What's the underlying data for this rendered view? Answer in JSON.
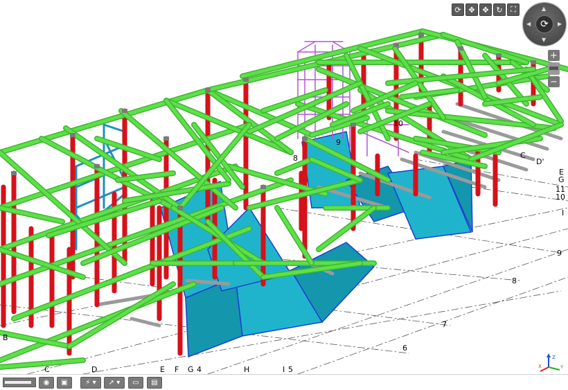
{
  "grid_labels": {
    "letters_bottom": [
      "B",
      "C",
      "D",
      "E",
      "F",
      "G",
      "H",
      "I"
    ],
    "bottom_numbers": [
      "4",
      "5"
    ],
    "right_letters": [
      "C",
      "D'",
      "E",
      "G",
      "11",
      "10",
      "I"
    ],
    "right_numbers": [
      "9",
      "8",
      "7",
      "6"
    ],
    "inner_numbers": [
      "8",
      "9",
      "10"
    ]
  },
  "colors": {
    "beam": "#5de04a",
    "beam_dark": "#3fb52f",
    "column": "#d6111a",
    "wall": "#1fb4cc",
    "wall_dark": "#1496ad",
    "tower": "#b455d6",
    "brace_blue": "#1e8fc0",
    "edge_blue": "#1b3fd0",
    "grey_beam": "#9a9a9a"
  },
  "toolbar": {
    "nav_icons": [
      "orbit-icon",
      "pan-icon",
      "move-icon",
      "rotate-icon",
      "fullscreen-icon"
    ],
    "wheel_center_icon": "orbit-icon",
    "zoom_in": "+",
    "zoom_out": "−"
  },
  "bottom_toolbar": {
    "slider_value": 0.9,
    "buttons": [
      "eye-icon",
      "cube-icon",
      "lightning-icon",
      "arrow-icon",
      "comment-icon",
      "document-icon"
    ]
  },
  "axis": {
    "x": "X",
    "y": "Y",
    "z": "Z"
  }
}
